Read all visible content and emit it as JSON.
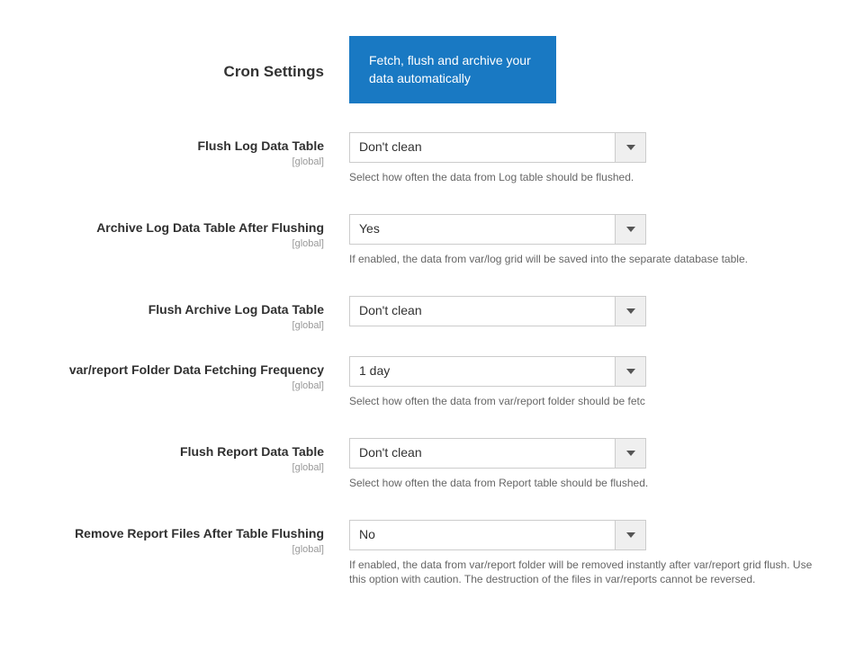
{
  "section": {
    "title": "Cron Settings",
    "banner": "Fetch, flush and archive your data automatically"
  },
  "scope_label": "[global]",
  "fields": {
    "flush_log": {
      "label": "Flush Log Data Table",
      "value": "Don't clean",
      "note": "Select how often the data from Log table should be flushed."
    },
    "archive_log": {
      "label": "Archive Log Data Table After Flushing",
      "value": "Yes",
      "note": "If enabled, the data from var/log grid will be saved into the separate database table."
    },
    "flush_archive": {
      "label": "Flush Archive Log Data Table",
      "value": "Don't clean"
    },
    "report_freq": {
      "label": "var/report Folder Data Fetching Frequency",
      "value": "1 day",
      "note": "Select how often the data from var/report folder should be fetc"
    },
    "flush_report": {
      "label": "Flush Report Data Table",
      "value": "Don't clean",
      "note": "Select how often the data from Report table should be flushed."
    },
    "remove_report": {
      "label": "Remove Report Files After Table Flushing",
      "value": "No",
      "note": "If enabled, the data from var/report folder will be removed instantly after var/report grid flush. Use this option with caution. The destruction of the files in var/reports cannot be reversed."
    }
  }
}
